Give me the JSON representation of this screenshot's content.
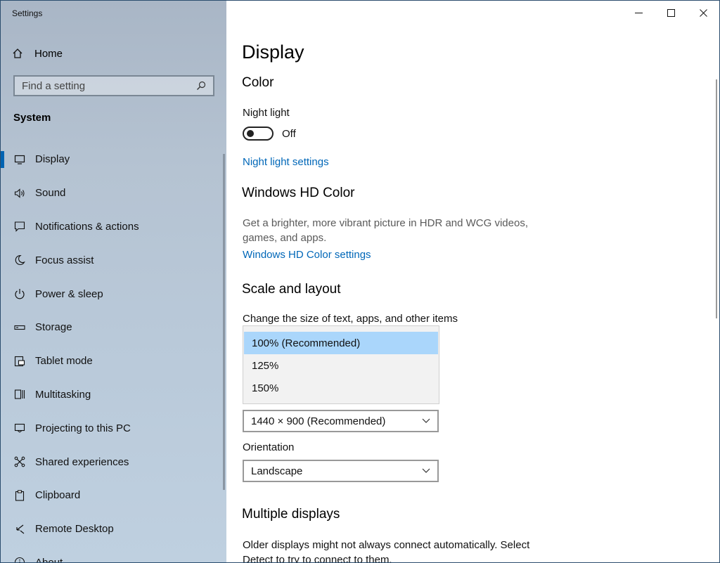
{
  "window": {
    "title": "Settings"
  },
  "sidebar": {
    "home_label": "Home",
    "search_placeholder": "Find a setting",
    "section_label": "System",
    "items": [
      {
        "label": "Display",
        "icon": "monitor-icon",
        "active": true
      },
      {
        "label": "Sound",
        "icon": "speaker-icon"
      },
      {
        "label": "Notifications & actions",
        "icon": "notification-icon"
      },
      {
        "label": "Focus assist",
        "icon": "moon-icon"
      },
      {
        "label": "Power & sleep",
        "icon": "power-icon"
      },
      {
        "label": "Storage",
        "icon": "storage-icon"
      },
      {
        "label": "Tablet mode",
        "icon": "tablet-icon"
      },
      {
        "label": "Multitasking",
        "icon": "multitasking-icon"
      },
      {
        "label": "Projecting to this PC",
        "icon": "projecting-icon"
      },
      {
        "label": "Shared experiences",
        "icon": "shared-icon"
      },
      {
        "label": "Clipboard",
        "icon": "clipboard-icon"
      },
      {
        "label": "Remote Desktop",
        "icon": "remote-desktop-icon"
      },
      {
        "label": "About",
        "icon": "info-icon"
      }
    ]
  },
  "main": {
    "page_title": "Display",
    "color": {
      "heading": "Color",
      "night_light_label": "Night light",
      "night_light_state": "Off",
      "night_light_link": "Night light settings"
    },
    "hd_color": {
      "heading": "Windows HD Color",
      "description": "Get a brighter, more vibrant picture in HDR and WCG videos, games, and apps.",
      "link": "Windows HD Color settings"
    },
    "scale": {
      "heading": "Scale and layout",
      "change_size_label": "Change the size of text, apps, and other items",
      "options": [
        "100% (Recommended)",
        "125%",
        "150%"
      ],
      "selected_option": "100% (Recommended)",
      "resolution_value": "1440 × 900 (Recommended)",
      "orientation_label": "Orientation",
      "orientation_value": "Landscape"
    },
    "multiple": {
      "heading": "Multiple displays",
      "description": "Older displays might not always connect automatically. Select Detect to try to connect to them."
    }
  }
}
